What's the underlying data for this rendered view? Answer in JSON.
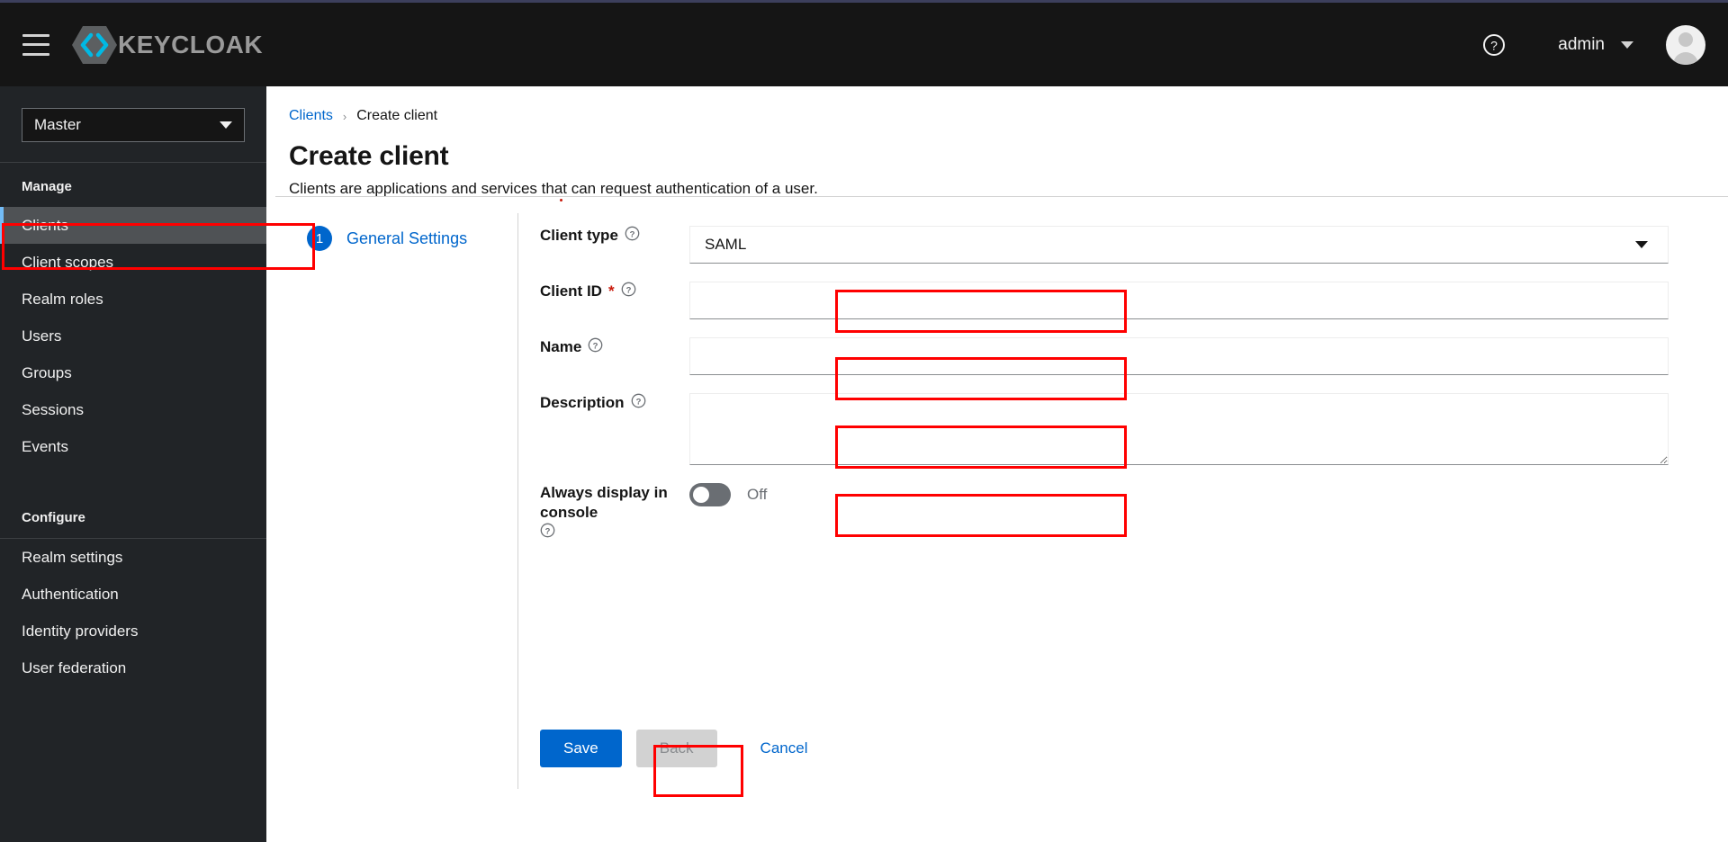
{
  "masthead": {
    "menu_icon": "hamburger-icon",
    "brand_name": "KEYCLOAK",
    "help_icon": "help-circle-icon",
    "user_name": "admin",
    "user_caret_icon": "chevron-down-icon",
    "avatar_icon": "user-avatar-icon"
  },
  "sidebar": {
    "realm": {
      "selected": "Master",
      "caret_icon": "caret-down-icon"
    },
    "groups": [
      {
        "title": "Manage",
        "items": [
          {
            "label": "Clients",
            "active": true
          },
          {
            "label": "Client scopes",
            "active": false
          },
          {
            "label": "Realm roles",
            "active": false
          },
          {
            "label": "Users",
            "active": false
          },
          {
            "label": "Groups",
            "active": false
          },
          {
            "label": "Sessions",
            "active": false
          },
          {
            "label": "Events",
            "active": false
          }
        ]
      },
      {
        "title": "Configure",
        "items": [
          {
            "label": "Realm settings",
            "active": false
          },
          {
            "label": "Authentication",
            "active": false
          },
          {
            "label": "Identity providers",
            "active": false
          },
          {
            "label": "User federation",
            "active": false
          }
        ]
      }
    ]
  },
  "page": {
    "breadcrumb": {
      "parent": "Clients",
      "separator": "›",
      "current": "Create client"
    },
    "title": "Create client",
    "subtitle": "Clients are applications and services that can request authentication of a user."
  },
  "wizard": {
    "steps": [
      {
        "number": "1",
        "label": "General Settings"
      }
    ]
  },
  "form": {
    "client_type": {
      "label": "Client type",
      "help_icon": "help-circle-icon",
      "value": "SAML",
      "caret_icon": "caret-down-icon"
    },
    "client_id": {
      "label": "Client ID",
      "required_marker": "*",
      "help_icon": "help-circle-icon",
      "value": "",
      "placeholder": ""
    },
    "name": {
      "label": "Name",
      "help_icon": "help-circle-icon",
      "value": "",
      "placeholder": ""
    },
    "description": {
      "label": "Description",
      "help_icon": "help-circle-icon",
      "value": "",
      "placeholder": ""
    },
    "always_display": {
      "label": "Always display in console",
      "help_icon": "help-circle-icon",
      "state_text": "Off",
      "checked": false
    }
  },
  "actions": {
    "save": "Save",
    "back": "Back",
    "cancel": "Cancel"
  },
  "colors": {
    "accent_blue": "#0066cc",
    "annotation_red": "#ff0000",
    "masthead_bg": "#151515",
    "sidebar_bg": "#212427",
    "active_nav_bg": "#4f5255",
    "active_nav_border": "#73bcf7",
    "required_red": "#c9190b",
    "toggle_off": "#6a6e73"
  }
}
